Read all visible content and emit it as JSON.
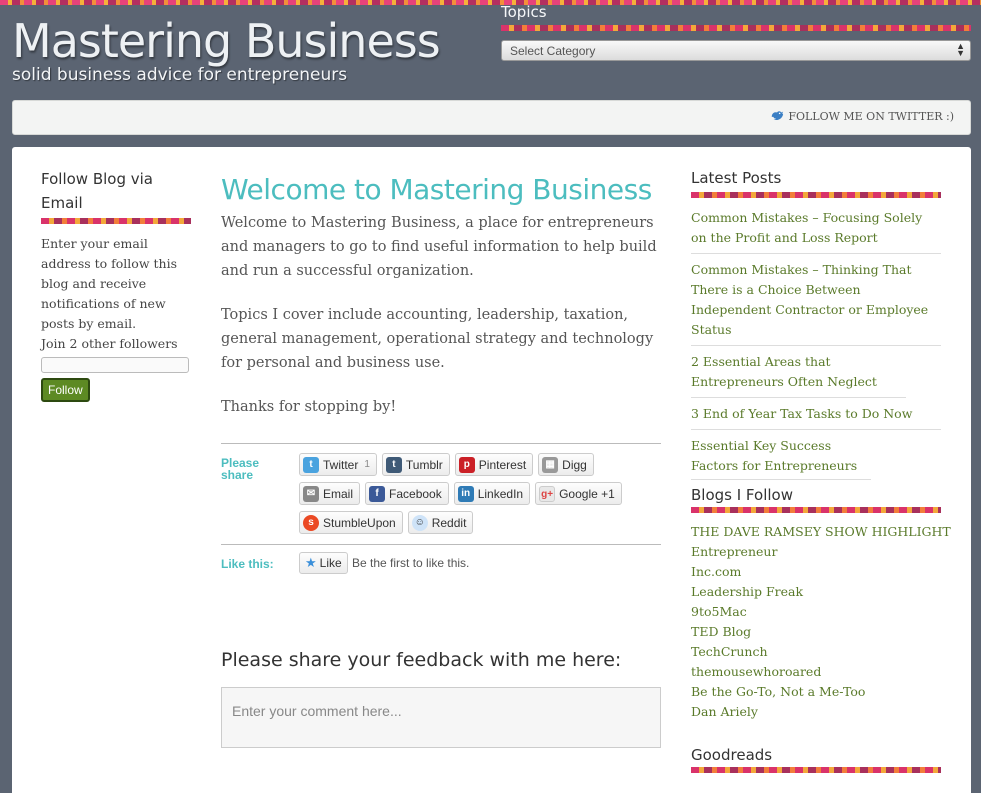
{
  "header": {
    "site_title": "Mastering Business",
    "tagline": "solid business advice for entrepreneurs",
    "topics_title": "Topics",
    "topics_select": "Select Category",
    "twitter_follow": "FOLLOW ME ON TWITTER :)"
  },
  "left": {
    "follow_title": "Follow Blog via Email",
    "follow_text": "Enter your email address to follow this blog and receive notifications of new posts by email.",
    "followers": "Join 2 other followers",
    "follow_button": "Follow"
  },
  "post": {
    "title": "Welcome to Mastering Business",
    "paragraphs": [
      "Welcome to Mastering Business, a place for entrepreneurs and managers to go to find useful information to help build and run a successful organization.",
      "Topics I cover include accounting, leadership, taxation, general management, operational strategy and technology for personal and business use.",
      "Thanks for stopping by!"
    ]
  },
  "share": {
    "label": "Please share",
    "buttons": [
      {
        "label": "Twitter",
        "count": "1"
      },
      {
        "label": "Tumblr"
      },
      {
        "label": "Pinterest"
      },
      {
        "label": "Digg"
      },
      {
        "label": "Email"
      },
      {
        "label": "Facebook"
      },
      {
        "label": "LinkedIn"
      },
      {
        "label": "Google +1"
      },
      {
        "label": "StumbleUpon"
      },
      {
        "label": "Reddit"
      }
    ]
  },
  "like": {
    "label": "Like this:",
    "button": "Like",
    "text": "Be the first to like this."
  },
  "feedback": {
    "title": "Please share your feedback with me here:",
    "placeholder": "Enter your comment here..."
  },
  "right": {
    "latest_title": "Latest Posts",
    "latest_posts": [
      "Common Mistakes – Focusing Solely on the Profit and Loss Report",
      "Common Mistakes – Thinking That There is a Choice Between Independent Contractor or Employee Status",
      "2 Essential Areas that Entrepreneurs Often Neglect",
      "3 End of Year Tax Tasks to Do Now",
      "Essential Key Success Factors for Entrepreneurs"
    ],
    "blogs_title": "Blogs I Follow",
    "blogs": [
      "THE DAVE RAMSEY SHOW HIGHLIGHT",
      "Entrepreneur",
      "Inc.com",
      "Leadership Freak",
      "9to5Mac",
      "TED Blog",
      "TechCrunch",
      "themousewhoroared",
      "Be the Go-To, Not a Me-Too",
      "Dan Ariely"
    ],
    "goodreads_title": "Goodreads"
  },
  "colors": {
    "background": "#5b6472",
    "accent_teal": "#4cbdbf",
    "link_green": "#5a7a2a",
    "follow_button": "#5d8a23"
  }
}
